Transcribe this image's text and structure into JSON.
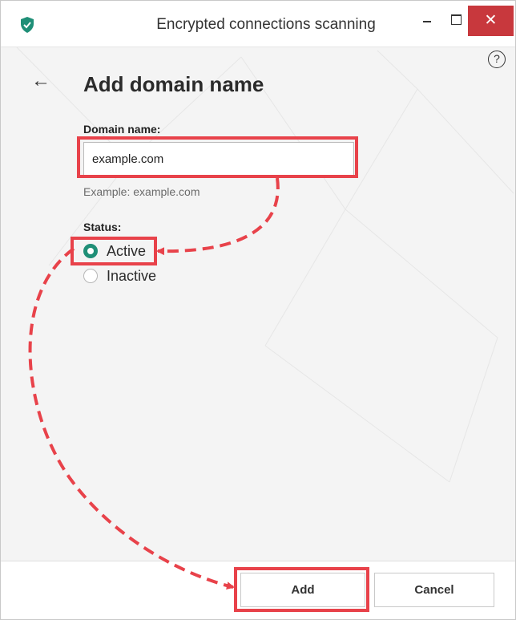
{
  "window": {
    "title": "Encrypted connections scanning",
    "close_glyph": "✕",
    "app_icon": "shield-icon"
  },
  "page": {
    "heading": "Add domain name",
    "back_glyph": "←",
    "help_glyph": "?"
  },
  "form": {
    "domain_label": "Domain name:",
    "domain_value": "example.com",
    "domain_hint": "Example: example.com",
    "status_label": "Status:",
    "status_options": [
      {
        "label": "Active",
        "selected": true
      },
      {
        "label": "Inactive",
        "selected": false
      }
    ]
  },
  "buttons": {
    "add": "Add",
    "cancel": "Cancel"
  },
  "colors": {
    "accent": "#1f8f77",
    "highlight": "#e8424a",
    "close_button": "#c8383d"
  }
}
